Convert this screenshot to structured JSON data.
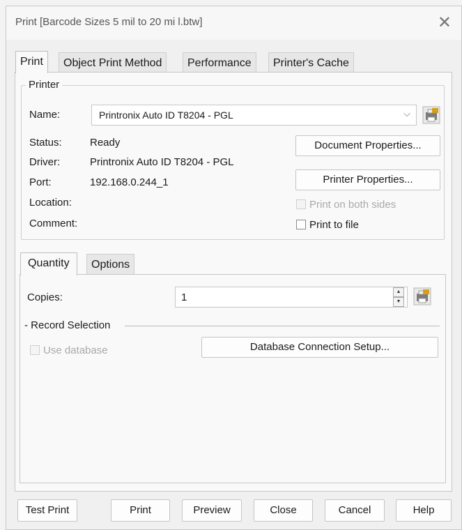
{
  "window": {
    "title": "Print [Barcode Sizes 5 mil to 20 mi l.btw]"
  },
  "tabs": [
    "Print",
    "Object Print Method",
    "Performance",
    "Printer's Cache"
  ],
  "printer": {
    "group_label": "Printer",
    "name_label": "Name:",
    "name_value": "Printronix Auto ID T8204 - PGL",
    "status_label": "Status:",
    "status_value": "Ready",
    "driver_label": "Driver:",
    "driver_value": "Printronix Auto ID T8204 - PGL",
    "port_label": "Port:",
    "port_value": "192.168.0.244_1",
    "location_label": "Location:",
    "comment_label": "Comment:",
    "document_properties_label": "Document Properties...",
    "printer_properties_label": "Printer Properties...",
    "print_both_sides_label": "Print on both sides",
    "print_to_file_label": "Print to file"
  },
  "subtabs": [
    "Quantity",
    "Options"
  ],
  "quantity": {
    "copies_label": "Copies:",
    "copies_value": "1",
    "record_selection_label": "- Record Selection",
    "use_database_label": "Use database",
    "database_setup_label": "Database Connection Setup..."
  },
  "footer": {
    "test_print": "Test Print",
    "print": "Print",
    "preview": "Preview",
    "close": "Close",
    "cancel": "Cancel",
    "help": "Help"
  },
  "icons": {
    "close": "close-icon",
    "printer_settings": "printer-settings-icon",
    "dropdown": "chevron-down-icon",
    "spinner": "spinner-icon"
  },
  "colors": {
    "background": "#f0f0f0",
    "panel": "#f9f9f9",
    "disabled_text": "#a9a9a9"
  }
}
